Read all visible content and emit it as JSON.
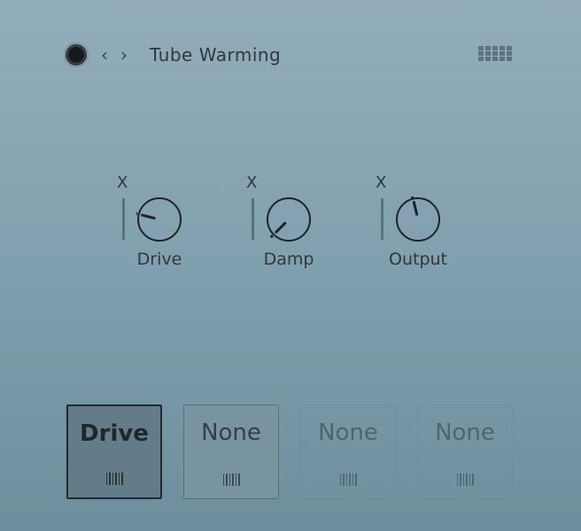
{
  "header": {
    "power_icon": "power-icon",
    "prev": "‹",
    "next": "›",
    "title": "Tube Warming",
    "grid_icon": "grid-icon"
  },
  "knobs": [
    {
      "label": "Drive",
      "mod_label": "X",
      "value": 0.22
    },
    {
      "label": "Damp",
      "mod_label": "X",
      "value": 0.0
    },
    {
      "label": "Output",
      "mod_label": "X",
      "value": 0.45
    }
  ],
  "slots": [
    {
      "label": "Drive",
      "state": "active"
    },
    {
      "label": "None",
      "state": "inactive"
    },
    {
      "label": "None",
      "state": "empty"
    },
    {
      "label": "None",
      "state": "empty"
    }
  ]
}
